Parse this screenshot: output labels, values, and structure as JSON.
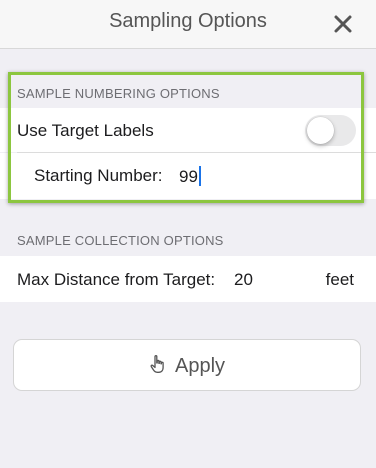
{
  "header": {
    "title": "Sampling Options",
    "close_icon": "close-icon"
  },
  "numbering": {
    "section_title": "SAMPLE NUMBERING OPTIONS",
    "use_target_labels": {
      "label": "Use Target Labels",
      "enabled": false
    },
    "starting_number": {
      "label": "Starting Number:",
      "value": "99"
    }
  },
  "collection": {
    "section_title": "SAMPLE COLLECTION OPTIONS",
    "max_distance": {
      "label": "Max Distance from Target:",
      "value": "20",
      "unit": "feet"
    }
  },
  "apply": {
    "label": "Apply",
    "icon": "hand-pointer-icon"
  },
  "colors": {
    "highlight": "#8cc63f",
    "caret": "#1a73e8"
  }
}
